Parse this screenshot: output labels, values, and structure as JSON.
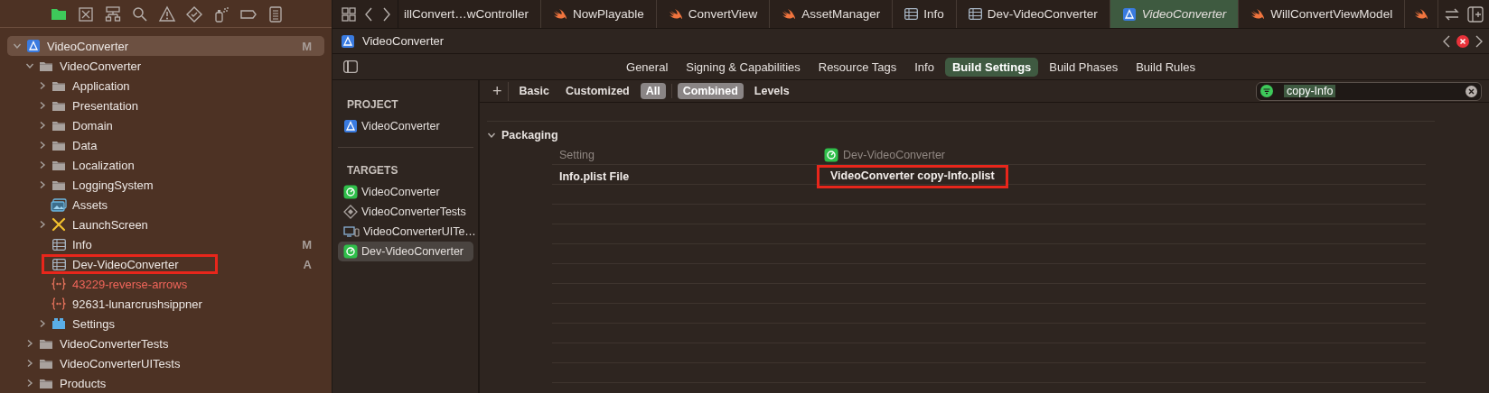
{
  "navigator": {
    "toolbar": [
      {
        "kind": "folder",
        "selected": true
      },
      {
        "kind": "xbox",
        "selected": false
      },
      {
        "kind": "hierarchy",
        "selected": false
      },
      {
        "kind": "search",
        "selected": false
      },
      {
        "kind": "warning",
        "selected": false
      },
      {
        "kind": "diamond",
        "selected": false
      },
      {
        "kind": "spray",
        "selected": false
      },
      {
        "kind": "capsule",
        "selected": false
      },
      {
        "kind": "list",
        "selected": false
      }
    ],
    "tree": [
      {
        "label": "VideoConverter",
        "kind": "project",
        "badge": "M",
        "expanded": true,
        "selected": true,
        "highlighted": false,
        "missing": false,
        "children": [
          {
            "label": "VideoConverter",
            "kind": "folder",
            "expanded": true,
            "selected": false,
            "highlighted": false,
            "missing": false,
            "children": [
              {
                "label": "Application",
                "kind": "folder",
                "expanded": false,
                "selected": false,
                "highlighted": false,
                "missing": false
              },
              {
                "label": "Presentation",
                "kind": "folder",
                "expanded": false,
                "selected": false,
                "highlighted": false,
                "missing": false
              },
              {
                "label": "Domain",
                "kind": "folder",
                "expanded": false,
                "selected": false,
                "highlighted": false,
                "missing": false
              },
              {
                "label": "Data",
                "kind": "folder",
                "expanded": false,
                "selected": false,
                "highlighted": false,
                "missing": false
              },
              {
                "label": "Localization",
                "kind": "folder",
                "expanded": false,
                "selected": false,
                "highlighted": false,
                "missing": false
              },
              {
                "label": "LoggingSystem",
                "kind": "folder",
                "expanded": false,
                "selected": false,
                "highlighted": false,
                "missing": false
              },
              {
                "label": "Assets",
                "kind": "assets",
                "selected": false,
                "highlighted": false,
                "missing": false
              },
              {
                "label": "LaunchScreen",
                "kind": "storyboard",
                "expanded": false,
                "selected": false,
                "highlighted": false,
                "missing": false
              },
              {
                "label": "Info",
                "kind": "plist",
                "badge": "M",
                "selected": false,
                "highlighted": false,
                "missing": false
              },
              {
                "label": "Dev-VideoConverter",
                "kind": "plist",
                "badge": "A",
                "selected": false,
                "highlighted": true,
                "missing": false
              },
              {
                "label": "43229-reverse-arrows",
                "kind": "json",
                "selected": false,
                "highlighted": false,
                "missing": true
              },
              {
                "label": "92631-lunarcrushsippner",
                "kind": "json",
                "selected": false,
                "highlighted": false,
                "missing": false
              },
              {
                "label": "Settings",
                "kind": "bundle",
                "expanded": false,
                "selected": false,
                "highlighted": false,
                "missing": false
              }
            ]
          },
          {
            "label": "VideoConverterTests",
            "kind": "folder",
            "expanded": false,
            "selected": false,
            "highlighted": false,
            "missing": false
          },
          {
            "label": "VideoConverterUITests",
            "kind": "folder",
            "expanded": false,
            "selected": false,
            "highlighted": false,
            "missing": false
          },
          {
            "label": "Products",
            "kind": "folder",
            "expanded": false,
            "selected": false,
            "highlighted": false,
            "missing": false
          }
        ]
      }
    ]
  },
  "editor_tabs": [
    {
      "label": "illConvert…wController",
      "kind": "cut",
      "selected": false
    },
    {
      "label": "NowPlayable",
      "kind": "swift",
      "selected": false
    },
    {
      "label": "ConvertView",
      "kind": "swift",
      "selected": false
    },
    {
      "label": "AssetManager",
      "kind": "swift",
      "selected": false
    },
    {
      "label": "Info",
      "kind": "plist",
      "selected": false
    },
    {
      "label": "Dev-VideoConverter",
      "kind": "plist",
      "selected": false
    },
    {
      "label": "VideoConverter",
      "kind": "project",
      "selected": true
    },
    {
      "label": "WillConvertViewModel",
      "kind": "swift",
      "selected": false
    },
    {
      "kind": "swift",
      "selected": false
    }
  ],
  "breadcrumb": {
    "label": "VideoConverter"
  },
  "target_tabs": [
    {
      "label": "General",
      "selected": false
    },
    {
      "label": "Signing & Capabilities",
      "selected": false
    },
    {
      "label": "Resource Tags",
      "selected": false
    },
    {
      "label": "Info",
      "selected": false
    },
    {
      "label": "Build Settings",
      "selected": true
    },
    {
      "label": "Build Phases",
      "selected": false
    },
    {
      "label": "Build Rules",
      "selected": false
    }
  ],
  "targets_pane": {
    "project_heading": "PROJECT",
    "project": [
      {
        "label": "VideoConverter",
        "kind": "project",
        "selected": false
      }
    ],
    "targets_heading": "TARGETS",
    "targets": [
      {
        "label": "VideoConverter",
        "kind": "app",
        "selected": false
      },
      {
        "label": "VideoConverterTests",
        "kind": "tests",
        "selected": false
      },
      {
        "label": "VideoConverterUITe…",
        "kind": "uitests",
        "selected": false
      },
      {
        "label": "Dev-VideoConverter",
        "kind": "app",
        "selected": true
      }
    ]
  },
  "filter_bar": {
    "add_button": "+",
    "scopes": [
      {
        "label": "Basic",
        "selected": false
      },
      {
        "label": "Customized",
        "selected": false
      },
      {
        "label": "All",
        "selected": true
      }
    ],
    "views": [
      {
        "label": "Combined",
        "selected": true
      },
      {
        "label": "Levels",
        "selected": false
      }
    ],
    "search": {
      "value": "copy-Info"
    }
  },
  "settings": {
    "section": "Packaging",
    "expanded": true,
    "columns": [
      "Setting",
      "Dev-VideoConverter"
    ],
    "rows": [
      {
        "name": "Info.plist File",
        "value": "VideoConverter copy-Info.plist",
        "highlighted": true
      }
    ]
  }
}
